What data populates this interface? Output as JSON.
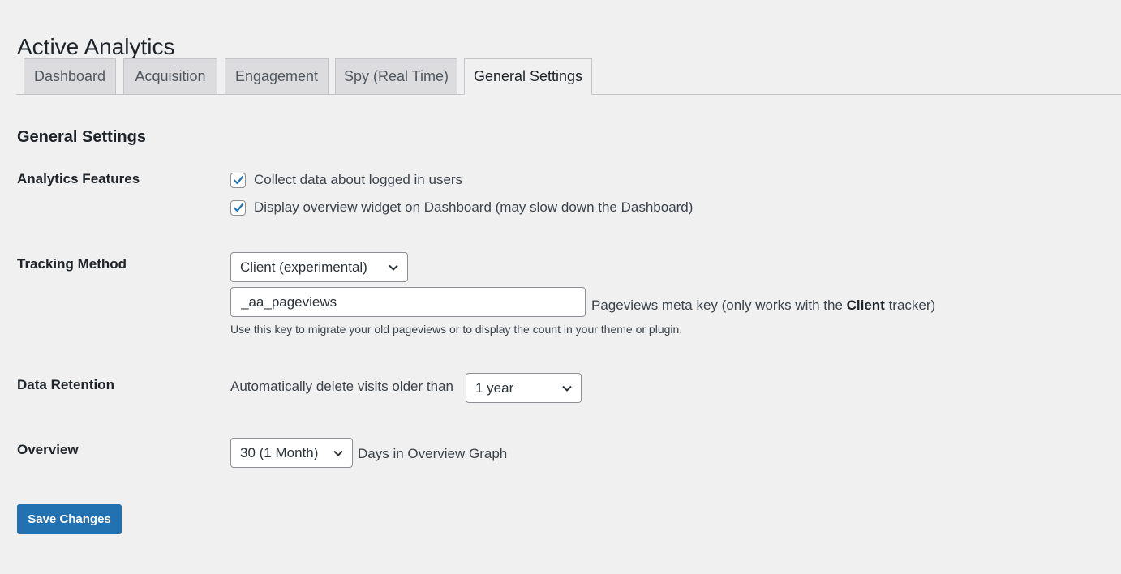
{
  "page": {
    "title": "Active Analytics"
  },
  "tabs": [
    {
      "label": "Dashboard",
      "active": false
    },
    {
      "label": "Acquisition",
      "active": false
    },
    {
      "label": "Engagement",
      "active": false
    },
    {
      "label": "Spy (Real Time)",
      "active": false
    },
    {
      "label": "General Settings",
      "active": true
    }
  ],
  "section": {
    "title": "General Settings"
  },
  "analytics_features": {
    "label": "Analytics Features",
    "options": [
      {
        "label": "Collect data about logged in users",
        "checked": true
      },
      {
        "label": "Display overview widget on Dashboard (may slow down the Dashboard)",
        "checked": true
      }
    ]
  },
  "tracking_method": {
    "label": "Tracking Method",
    "selected": "Client (experimental)",
    "meta_key_value": "_aa_pageviews",
    "meta_key_label_prefix": "Pageviews meta key (only works with the ",
    "meta_key_label_bold": "Client",
    "meta_key_label_suffix": " tracker)",
    "description": "Use this key to migrate your old pageviews or to display the count in your theme or plugin."
  },
  "data_retention": {
    "label": "Data Retention",
    "prefix": "Automatically delete visits older than",
    "selected": "1 year"
  },
  "overview": {
    "label": "Overview",
    "selected": "30 (1 Month)",
    "suffix": "Days in Overview Graph"
  },
  "actions": {
    "save_label": "Save Changes"
  },
  "colors": {
    "accent": "#2271b1",
    "background": "#f0f0f1",
    "tab_inactive": "#dcdcde"
  }
}
